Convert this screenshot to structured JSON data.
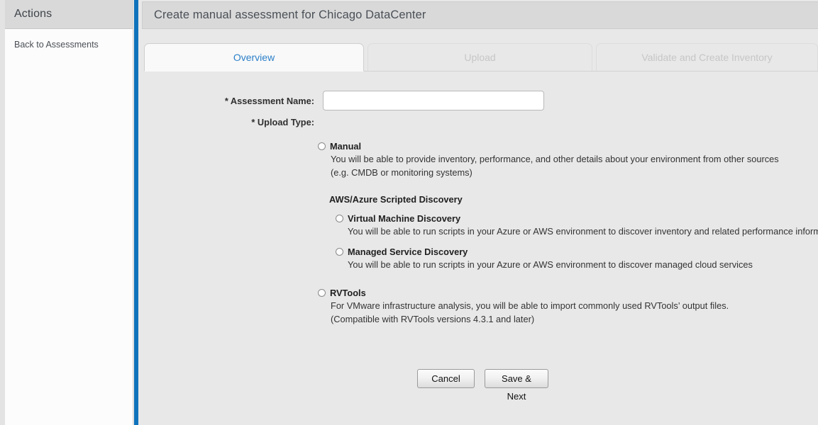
{
  "sidebar": {
    "header_title": "Actions",
    "links": [
      {
        "label": "Back to Assessments"
      }
    ]
  },
  "header": {
    "title": "Create manual assessment for Chicago DataCenter"
  },
  "tabs": [
    {
      "label": "Overview",
      "state": "active"
    },
    {
      "label": "Upload",
      "state": "disabled"
    },
    {
      "label": "Validate and Create Inventory",
      "state": "disabled"
    }
  ],
  "form": {
    "assessment_name_label": "* Assessment Name:",
    "assessment_name_value": "",
    "assessment_name_placeholder": "",
    "upload_type_label": "* Upload Type:",
    "options": {
      "manual": {
        "title": "Manual",
        "desc_line1": "You will be able to provide inventory, performance, and other details about your environment from other sources",
        "desc_line2": "(e.g. CMDB or monitoring systems)"
      },
      "group_title": "AWS/Azure Scripted Discovery",
      "vm_discovery": {
        "title": "Virtual Machine Discovery",
        "desc_line1": "You will be able to run scripts in your Azure or AWS environment to discover inventory and related performance information for machine imports"
      },
      "managed_service": {
        "title": "Managed Service Discovery",
        "desc_line1": "You will be able to run scripts in your Azure or AWS environment to discover managed cloud services"
      },
      "rvtools": {
        "title": "RVTools",
        "desc_line1": "For VMware infrastructure analysis, you will be able to import commonly used RVTools’ output files.",
        "desc_line2": "(Compatible with RVTools versions 4.3.1 and later)"
      }
    }
  },
  "buttons": {
    "cancel": "Cancel",
    "save_next": "Save & Next"
  },
  "colors": {
    "accent_blue": "#0f73bb",
    "active_tab_text": "#2b7fc9",
    "panel_background": "#e8e8e8",
    "header_background": "#d9d9d9"
  }
}
